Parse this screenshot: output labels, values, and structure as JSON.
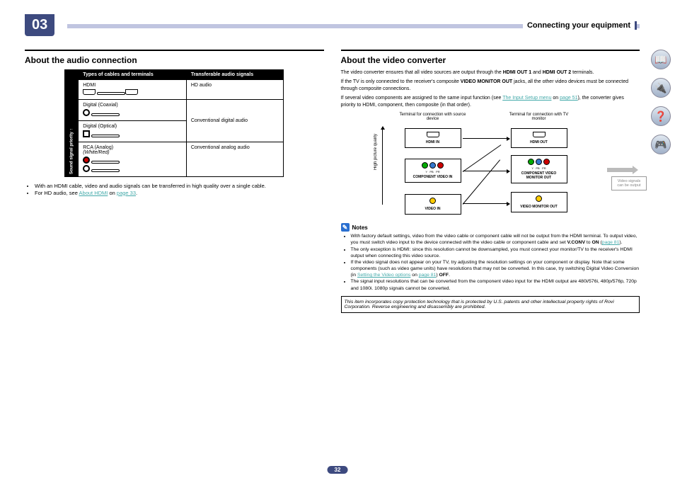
{
  "chapter_number": "03",
  "header_title": "Connecting your equipment",
  "audio": {
    "heading": "About the audio connection",
    "table": {
      "head_cables": "Types of cables and terminals",
      "head_signals": "Transferable audio signals",
      "priority_label": "Sound signal priority",
      "rows": [
        {
          "cable": "HDMI",
          "signal": "HD audio"
        },
        {
          "cable": "Digital (Coaxial)",
          "signal": "Conventional digital audio"
        },
        {
          "cable": "Digital (Optical)",
          "signal": ""
        },
        {
          "cable": "RCA (Analog)\n(White/Red)",
          "signal": "Conventional analog audio"
        }
      ]
    },
    "bullets": [
      {
        "text": "With an HDMI cable, video and audio signals can be transferred in high quality over a single cable."
      },
      {
        "text_before": "For HD audio, see ",
        "link": "About HDMI",
        "text_mid": " on ",
        "link2": "page 33",
        "text_after": "."
      }
    ]
  },
  "video": {
    "heading": "About the video converter",
    "para1_a": "The video converter ensures that all video sources are output through the ",
    "para1_b": "HDMI OUT 1",
    "para1_c": " and ",
    "para1_d": "HDMI OUT 2",
    "para1_e": " terminals.",
    "para2_a": "If the TV is only connected to the receiver's composite ",
    "para2_b": "VIDEO MONITOR OUT",
    "para2_c": " jacks, all the other video devices must be connected through composite connections.",
    "para3_a": "If several video components are assigned to the same input function (see ",
    "para3_link": "The Input Setup menu",
    "para3_b": " on ",
    "para3_link2": "page 51",
    "para3_c": "), the converter gives priority to HDMI, component, then composite (in that order).",
    "diagram": {
      "src_label": "Terminal for connection with source device",
      "tv_label": "Terminal for connection with TV monitor",
      "quality_label": "High picture quality",
      "hdmi_in": "HDMI IN",
      "hdmi_out": "HDMI OUT",
      "comp_in": "COMPONENT VIDEO IN",
      "comp_out": "COMPONENT VIDEO MONITOR OUT",
      "video_in": "VIDEO IN",
      "video_out": "VIDEO MONITOR OUT",
      "ypbpr": [
        "Y",
        "PB",
        "PR"
      ],
      "signals_note": "Video signals can be output"
    },
    "notes_heading": "Notes",
    "notes": [
      {
        "t1": "With factory default settings, video from the video cable or component cable will not be output from the HDMI terminal. To output video, you must switch video input to the device connected with the video cable or component cable and set ",
        "b1": "V.CONV",
        "t2": " to ",
        "b2": "ON",
        "t3": " (",
        "link": "page 81",
        "t4": ")."
      },
      {
        "t1": "The only exception is HDMI: since this resolution cannot be downsampled, you must connect your monitor/TV to the receiver's HDMI output when connecting this video source."
      },
      {
        "t1": "If the video signal does not appear on your TV, try adjusting the resolution settings on your component or display. Note that some components (such as video game units) have resolutions that may not be converted. In this case, try switching Digital Video Conversion (in ",
        "link": "Setting the Video options",
        "t2": " on ",
        "link2": "page 81",
        "t3": ") ",
        "b1": "OFF",
        "t4": "."
      },
      {
        "t1": "The signal input resolutions that can be converted from the component video input for the HDMI output are 480i/576i, 480p/576p, 720p and 1080i. 1080p signals cannot be converted."
      }
    ],
    "copy_protection": "This item incorporates copy protection technology that is protected by U.S. patents and other intellectual property rights of Rovi Corporation. Reverse engineering and disassembly are prohibited."
  },
  "sidebar": {
    "btn1": "book-icon",
    "btn2": "device-icon",
    "btn3": "help-icon",
    "btn4": "remote-icon"
  },
  "page_number": "32"
}
